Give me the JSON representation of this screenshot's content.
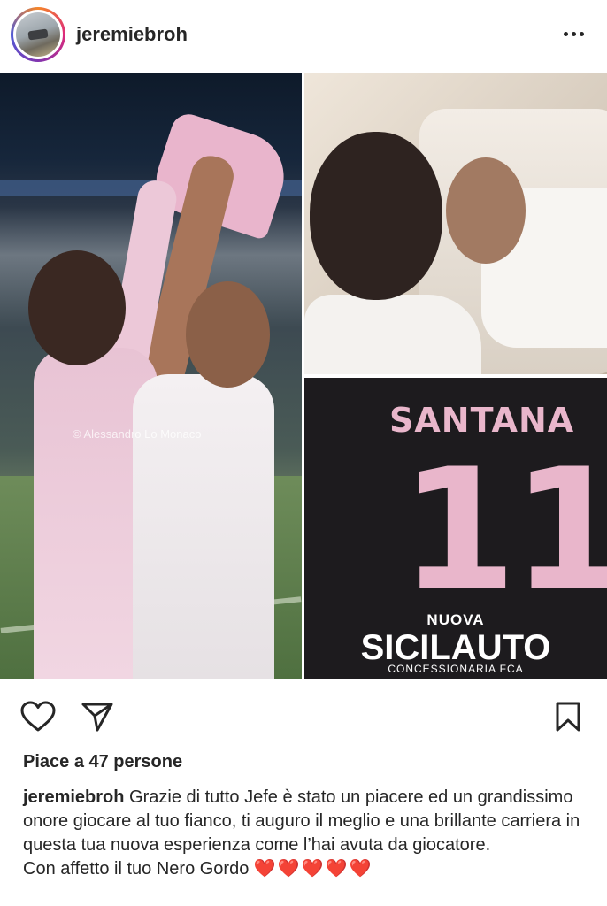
{
  "post": {
    "username": "jeremiebroh",
    "likes_text": "Piace a 47 persone",
    "caption_user": "jeremiebroh",
    "caption_text": " Grazie di tutto Jefe è stato un piacere ed un grandissimo onore giocare al tuo fianco, ti auguro il meglio e una brillante carriera in questa tua nuova esperienza come l’hai avuta da giocatore.",
    "caption_line2": "Con affetto il tuo Nero Gordo ",
    "caption_hearts": "❤️❤️❤️❤️❤️"
  },
  "images": {
    "watermark": "© Alessandro Lo Monaco",
    "shirt_name": "SANTANA",
    "shirt_number": "11",
    "sponsor_small": "NUOVA",
    "sponsor_big": "SICILAUTO",
    "sponsor_sub": "CONCESSIONARIA FCA"
  },
  "icons": {
    "more": "more-options-icon",
    "like": "heart-icon",
    "share": "send-icon",
    "save": "bookmark-icon"
  },
  "colors": {
    "text": "#262626",
    "heart": "#e0202f",
    "shirt_pink": "#e9b6cb"
  }
}
